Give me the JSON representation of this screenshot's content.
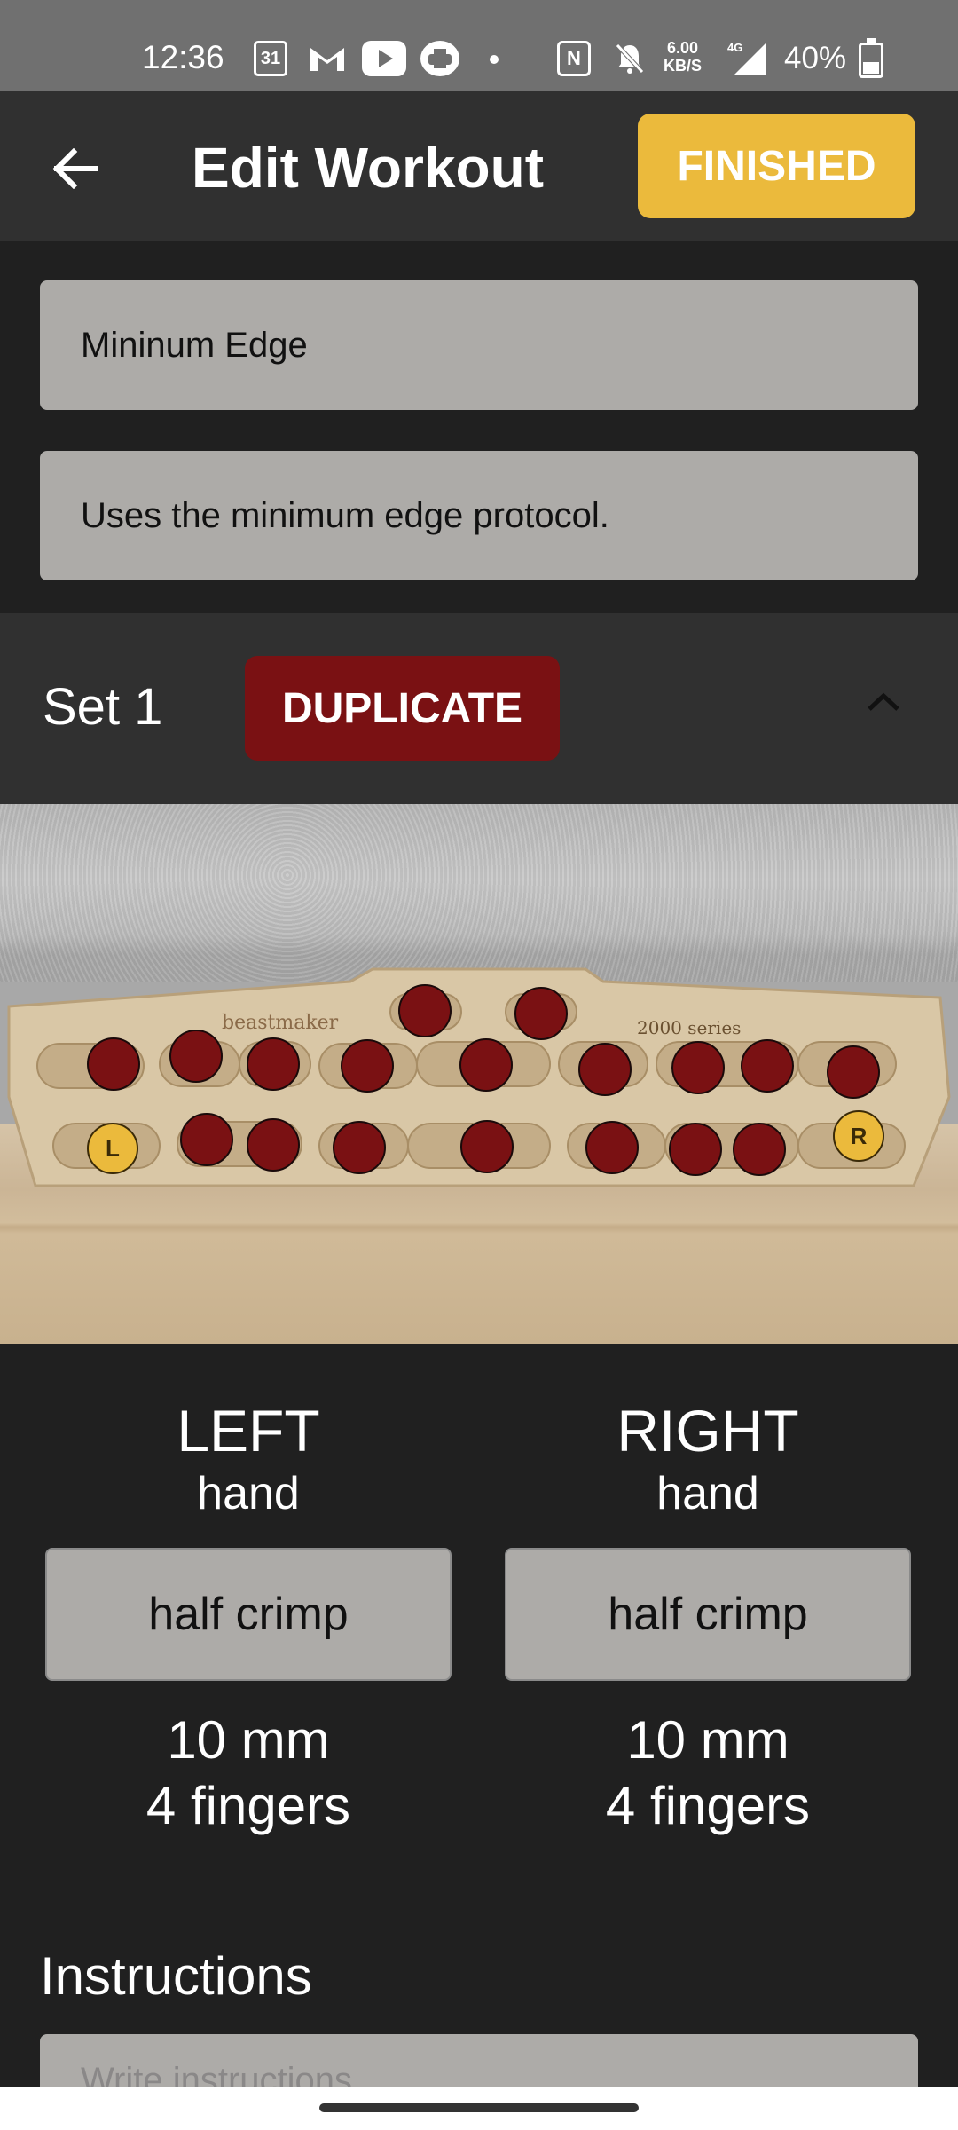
{
  "status_bar": {
    "time": "12:36",
    "calendar_day": "31",
    "speed_value": "6.00",
    "speed_unit": "KB/S",
    "network": "4G",
    "battery_text": "40%",
    "battery_level": 0.4
  },
  "app_bar": {
    "title": "Edit Workout",
    "finished_label": "FINISHED"
  },
  "workout": {
    "name": "Mininum Edge",
    "description": "Uses the minimum edge protocol."
  },
  "set": {
    "label": "Set 1",
    "duplicate_label": "DUPLICATE",
    "board_logo": "beastmaker",
    "board_series": "2000 series",
    "left_marker": "L",
    "right_marker": "R"
  },
  "left_hand": {
    "side": "LEFT",
    "word": "hand",
    "grip": "half crimp",
    "size": "10 mm",
    "fingers": "4 fingers"
  },
  "right_hand": {
    "side": "RIGHT",
    "word": "hand",
    "grip": "half crimp",
    "size": "10 mm",
    "fingers": "4 fingers"
  },
  "instructions": {
    "label": "Instructions",
    "placeholder": "Write instructions"
  },
  "colors": {
    "accent_yellow": "#ebba3c",
    "accent_red": "#7a1113",
    "background": "#202020",
    "appbar": "#303030",
    "field": "#adaba8"
  }
}
